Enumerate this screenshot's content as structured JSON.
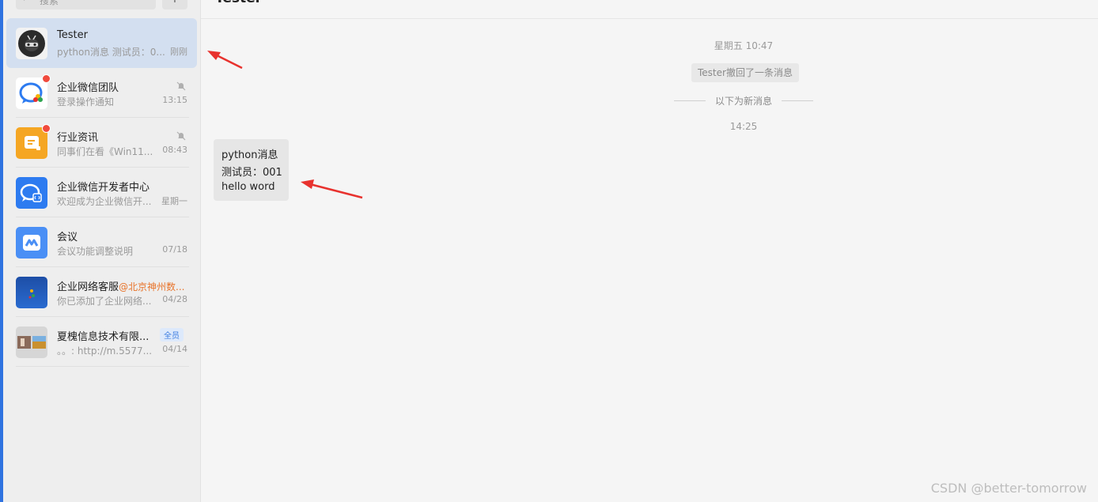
{
  "search": {
    "placeholder": "搜索",
    "add_label": "+"
  },
  "conversations": [
    {
      "name": "Tester",
      "preview": "python消息 测试员：0...",
      "time": "刚刚",
      "active": true
    },
    {
      "name": "企业微信团队",
      "preview": "登录操作通知",
      "time": "13:15",
      "unread": true,
      "muted": true
    },
    {
      "name": "行业资讯",
      "preview": "同事们在看《Win11...",
      "time": "08:43",
      "unread": true,
      "muted": true
    },
    {
      "name": "企业微信开发者中心",
      "preview": "欢迎成为企业微信开...",
      "time": "星期一"
    },
    {
      "name": "会议",
      "preview": "会议功能调整说明",
      "time": "07/18"
    },
    {
      "name": "企业网络客服",
      "at": "@北京神州数...",
      "preview": "你已添加了企业网络...",
      "time": "04/28"
    },
    {
      "name": "夏槐信息技术有限...",
      "tag": "全员",
      "preview": "。。: http://m.5577...",
      "time": "04/14"
    }
  ],
  "chat": {
    "title": "Tester",
    "day_time": "星期五 10:47",
    "recall_notice": "Tester撤回了一条消息",
    "new_messages_divider": "以下为新消息",
    "msg_time": "14:25",
    "message_lines": [
      "python消息",
      "测试员：001",
      "hello word"
    ]
  },
  "watermark": "CSDN @better-tomorrow",
  "colors": {
    "accent": "#2f73e0",
    "active_bg": "#d3dff0",
    "unread_dot": "#f04a3d",
    "arrow": "#e8322e"
  }
}
